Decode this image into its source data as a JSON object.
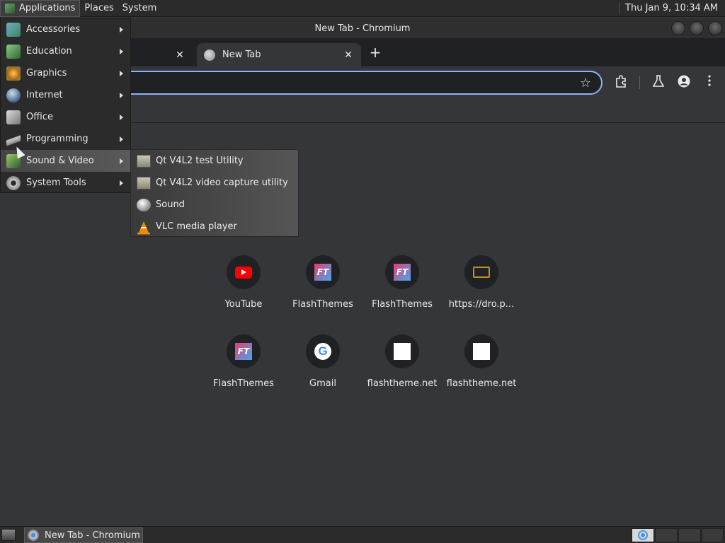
{
  "top_panel": {
    "menus": [
      {
        "label": "Applications"
      },
      {
        "label": "Places"
      },
      {
        "label": "System"
      }
    ],
    "clock": "Thu Jan  9, 10:34 AM"
  },
  "window": {
    "title": "New Tab - Chromium"
  },
  "tabs": [
    {
      "label": ""
    },
    {
      "label": "New Tab"
    }
  ],
  "toolbar": {
    "new_tab_symbol": "+",
    "star_symbol": "☆"
  },
  "shortcuts": [
    {
      "label": "YouTube",
      "icon": "youtube-icon"
    },
    {
      "label": "FlashThemes",
      "icon": "flashthemes-icon"
    },
    {
      "label": "FlashThemes",
      "icon": "flashthemes-icon"
    },
    {
      "label": "https://dro.p...",
      "icon": "dro-icon"
    },
    {
      "label": "FlashThemes",
      "icon": "flashthemes-icon"
    },
    {
      "label": "Gmail",
      "icon": "google-icon"
    },
    {
      "label": "flashtheme.net",
      "icon": "blank-page-icon"
    },
    {
      "label": "flashtheme.net",
      "icon": "blank-page-icon"
    }
  ],
  "apps_menu": {
    "items": [
      {
        "label": "Accessories"
      },
      {
        "label": "Education"
      },
      {
        "label": "Graphics"
      },
      {
        "label": "Internet"
      },
      {
        "label": "Office"
      },
      {
        "label": "Programming"
      },
      {
        "label": "Sound & Video"
      },
      {
        "label": "System Tools"
      }
    ],
    "highlighted": "Sound & Video"
  },
  "submenu": {
    "items": [
      {
        "label": "Qt V4L2 test Utility"
      },
      {
        "label": "Qt V4L2 video capture utility"
      },
      {
        "label": "Sound"
      },
      {
        "label": "VLC media player"
      }
    ]
  },
  "taskbar": {
    "task_label": "New Tab - Chromium"
  },
  "colors": {
    "accent": "#8ab4f8",
    "page_bg": "#35363a",
    "panel_bg": "#2b2b2b"
  }
}
